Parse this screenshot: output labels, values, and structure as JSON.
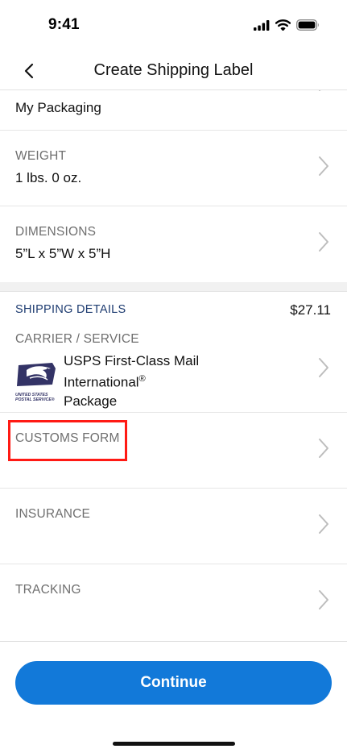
{
  "status_bar": {
    "time": "9:41"
  },
  "nav": {
    "title": "Create Shipping Label"
  },
  "package_rows": [
    {
      "label": "",
      "value": "My Packaging"
    },
    {
      "label": "WEIGHT",
      "value": "1 lbs.  0 oz."
    },
    {
      "label": "DIMENSIONS",
      "value": "5”L x 5”W x 5”H"
    }
  ],
  "shipping_details": {
    "header": "SHIPPING DETAILS",
    "price": "$27.11",
    "carrier_label": "CARRIER / SERVICE",
    "carrier_line1": "USPS First-Class Mail",
    "carrier_line2": "International",
    "carrier_reg": "®",
    "carrier_line3": "Package",
    "logo_line1": "UNITED STATES",
    "logo_line2": "POSTAL SERVICE®",
    "customs_label": "CUSTOMS FORM",
    "insurance_label": "INSURANCE",
    "tracking_label": "TRACKING"
  },
  "footer": {
    "continue_label": "Continue"
  },
  "colors": {
    "accent": "#1279d9",
    "section_header": "#1d3b70",
    "highlight": "#ff1a14",
    "usps_blue": "#333366"
  }
}
